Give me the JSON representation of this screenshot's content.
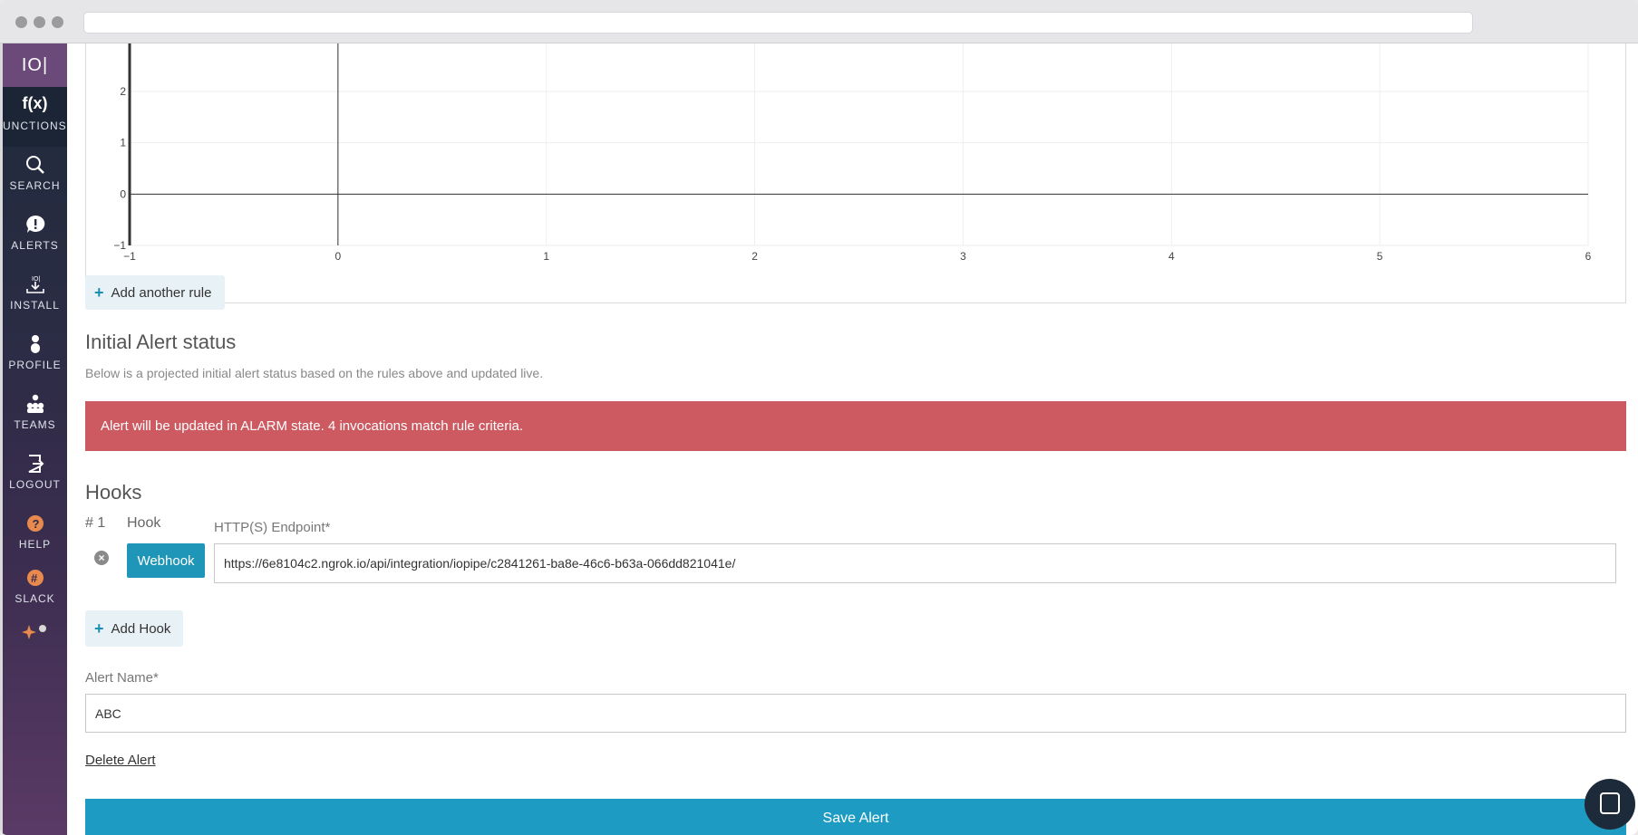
{
  "sidebar": {
    "logo": "IO|",
    "items": [
      {
        "label": "UNCTIONS",
        "icon": "f(x)"
      },
      {
        "label": "SEARCH",
        "icon": "search-icon"
      },
      {
        "label": "ALERTS",
        "icon": "alert-icon"
      },
      {
        "label": "INSTALL",
        "icon": "install-icon"
      },
      {
        "label": "PROFILE",
        "icon": "profile-icon"
      },
      {
        "label": "TEAMS",
        "icon": "teams-icon"
      },
      {
        "label": "LOGOUT",
        "icon": "logout-icon"
      },
      {
        "label": "HELP",
        "icon": "help-icon"
      },
      {
        "label": "SLACK",
        "icon": "slack-icon"
      }
    ]
  },
  "chart_data": {
    "type": "line",
    "x_ticks": [
      "−1",
      "0",
      "1",
      "2",
      "3",
      "4",
      "5",
      "6"
    ],
    "y_ticks": [
      "2",
      "1",
      "0",
      "−1"
    ],
    "xlim": [
      -1,
      6
    ],
    "ylim": [
      -1,
      2
    ],
    "grid": true,
    "series": []
  },
  "rules": {
    "add_rule_label": "Add another rule"
  },
  "status": {
    "heading": "Initial Alert status",
    "subtitle": "Below is a projected initial alert status based on the rules above and updated live.",
    "alarm_text": "Alert will be updated in ALARM state. 4 invocations match rule criteria."
  },
  "hooks": {
    "heading": "Hooks",
    "index_label": "# 1",
    "hook_label": "Hook",
    "endpoint_label": "HTTP(S) Endpoint*",
    "type_button": "Webhook",
    "endpoint_value": "https://6e8104c2.ngrok.io/api/integration/iopipe/c2841261-ba8e-46c6-b63a-066dd821041e/",
    "add_hook_label": "Add Hook"
  },
  "alert_name": {
    "label": "Alert Name*",
    "value": "ABC"
  },
  "actions": {
    "delete_label": "Delete Alert",
    "save_label": "Save Alert"
  }
}
